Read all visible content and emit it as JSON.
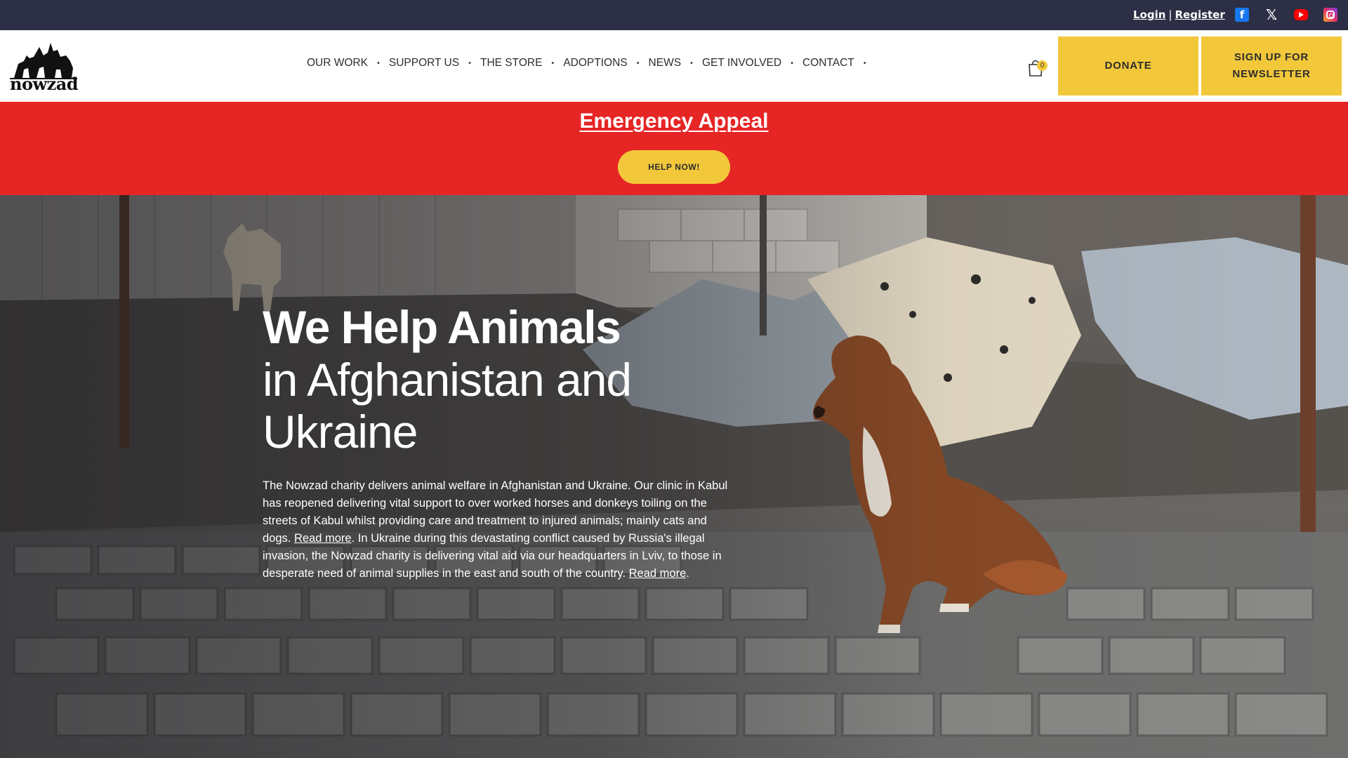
{
  "topbar": {
    "login": "Login",
    "separator": "|",
    "register": "Register",
    "social": [
      "facebook-icon",
      "x-icon",
      "youtube-icon",
      "instagram-icon"
    ],
    "background": "#2c2f45"
  },
  "header": {
    "logo_text": "nowzad",
    "nav": [
      "OUR WORK",
      "SUPPORT US",
      "THE STORE",
      "ADOPTIONS",
      "NEWS",
      "GET INVOLVED",
      "CONTACT"
    ],
    "cart_count": "0",
    "donate_label": "DONATE",
    "newsletter_label": "SIGN UP FOR NEWSLETTER",
    "accent": "#f2c83a"
  },
  "banner": {
    "title": "Emergency Appeal",
    "button": "HELP NOW!",
    "background": "#e62525"
  },
  "hero": {
    "heading_bold": "We Help Animals",
    "heading_light": "in Afghanistan and Ukraine",
    "intro_1": "The Nowzad charity delivers animal welfare in Afghanistan and Ukraine. Our clinic in Kabul has reopened delivering vital support to over worked horses and donkeys toiling on the streets of Kabul whilst providing care and treatment to injured animals; mainly cats and dogs. ",
    "read_more_1": "Read more",
    "intro_2": ". In Ukraine during this devastating conflict caused by Russia's illegal invasion, the Nowzad charity is delivering vital aid via our headquarters in Lviv, to those in desperate need of animal supplies in the east and south of the country. ",
    "read_more_2": "Read more",
    "intro_end": "."
  }
}
